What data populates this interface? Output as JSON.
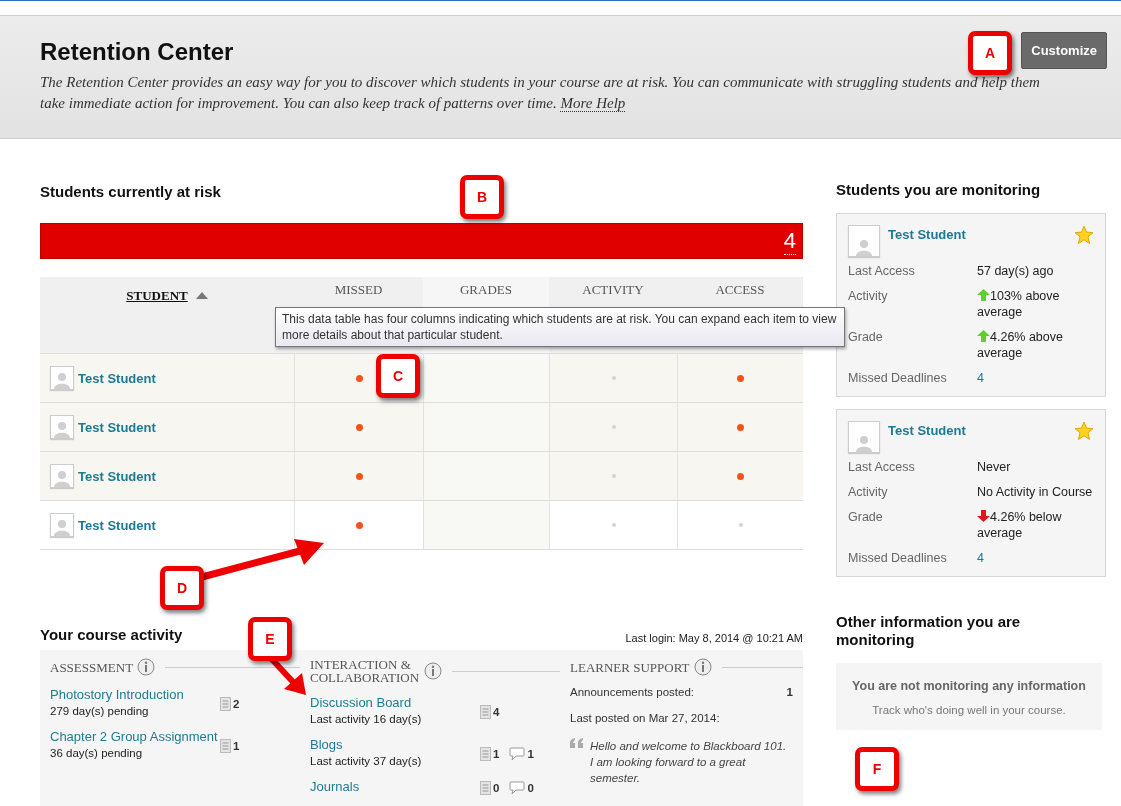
{
  "header": {
    "title": "Retention Center",
    "description": "The Retention Center provides an easy way for you to discover which students in your course are at risk. You can communicate with struggling students and help them take immediate action for improvement. You can also keep track of patterns over time.",
    "help_link": "More Help",
    "button": "Customize"
  },
  "at_risk": {
    "title": "Students currently at risk",
    "count": "4"
  },
  "table": {
    "columns": [
      {
        "label": "STUDENT",
        "sorted": true
      },
      {
        "label": "MISSED",
        "sorted": false
      },
      {
        "label": "GRADES",
        "sorted": false
      },
      {
        "label": "ACTIVITY",
        "sorted": false
      },
      {
        "label": "ACCESS",
        "sorted": false
      }
    ],
    "tooltip": "This data table has four columns indicating which students are at risk. You can expand each item to view more details about that particular student.",
    "rows": [
      {
        "name": "Test Student",
        "shaded": true,
        "cells": [
          {
            "kind": "dot",
            "alert": true
          },
          {
            "kind": "blank"
          },
          {
            "kind": "dot",
            "alert": false
          },
          {
            "kind": "dot",
            "alert": true
          }
        ]
      },
      {
        "name": "Test Student",
        "shaded": true,
        "cells": [
          {
            "kind": "dot",
            "alert": true
          },
          {
            "kind": "blank"
          },
          {
            "kind": "dot",
            "alert": false
          },
          {
            "kind": "dot",
            "alert": true
          }
        ]
      },
      {
        "name": "Test Student",
        "shaded": true,
        "cells": [
          {
            "kind": "dot",
            "alert": true
          },
          {
            "kind": "blank"
          },
          {
            "kind": "dot",
            "alert": false
          },
          {
            "kind": "dot",
            "alert": true
          }
        ]
      },
      {
        "name": "Test Student",
        "shaded": false,
        "cells": [
          {
            "kind": "dot",
            "alert": true
          },
          {
            "kind": "blank"
          },
          {
            "kind": "dot",
            "alert": false
          },
          {
            "kind": "dot",
            "alert": false
          }
        ]
      }
    ]
  },
  "monitoring": {
    "title": "Students you are monitoring",
    "students": [
      {
        "name": "Test Student",
        "starred": true,
        "fields": [
          {
            "label": "Last Access",
            "value": "57 day(s) ago"
          },
          {
            "label": "Activity",
            "value": "103% above average",
            "rising": true
          },
          {
            "label": "Grade",
            "value": "4.26% above average",
            "rising": true
          },
          {
            "label": "Missed Deadlines",
            "value": "4",
            "link": true
          }
        ]
      },
      {
        "name": "Test Student",
        "starred": true,
        "fields": [
          {
            "label": "Last Access",
            "value": "Never"
          },
          {
            "label": "Activity",
            "value": "No Activity in Course"
          },
          {
            "label": "Grade",
            "value": "4.26% below average",
            "rising": false
          },
          {
            "label": "Missed Deadlines",
            "value": "4",
            "link": true
          }
        ]
      }
    ]
  },
  "course_activity": {
    "title": "Your course activity",
    "last_login": "Last login: May 8, 2014 @ 10:21 AM",
    "assessment": {
      "title": "ASSESSMENT",
      "items": [
        {
          "title": "Photostory Introduction",
          "detail": "279 day(s) pending",
          "counts": [
            {
              "kind": "doc",
              "value": "2"
            }
          ]
        },
        {
          "title": "Chapter 2 Group Assignment",
          "detail": "36 day(s) pending",
          "counts": [
            {
              "kind": "doc",
              "value": "1"
            }
          ]
        }
      ]
    },
    "interaction": {
      "title": "INTERACTION & COLLABORATION",
      "items": [
        {
          "title": "Discussion Board",
          "detail": "Last activity 16 day(s)",
          "counts": [
            {
              "kind": "doc",
              "value": "4"
            }
          ]
        },
        {
          "title": "Blogs",
          "detail": "Last activity 37 day(s)",
          "counts": [
            {
              "kind": "doc",
              "value": "1"
            },
            {
              "kind": "comment",
              "value": "1"
            }
          ]
        },
        {
          "title": "Journals",
          "counts": [
            {
              "kind": "doc",
              "value": "0"
            },
            {
              "kind": "comment",
              "value": "0"
            }
          ]
        }
      ]
    },
    "learner_support": {
      "title": "LEARNER SUPPORT",
      "announcements_label": "Announcements posted:",
      "announcements_count": "1",
      "last_posted": "Last posted on Mar 27, 2014:",
      "quote": "Hello and welcome to Blackboard 101. I am looking forward to a great semester."
    }
  },
  "other_info": {
    "title": "Other information you are monitoring",
    "empty_title": "You are not monitoring any information",
    "empty_text": "Track who's doing well in your course."
  },
  "callouts": [
    {
      "label": "A"
    },
    {
      "label": "B"
    },
    {
      "label": "C"
    },
    {
      "label": "D"
    },
    {
      "label": "E"
    },
    {
      "label": "F"
    }
  ]
}
